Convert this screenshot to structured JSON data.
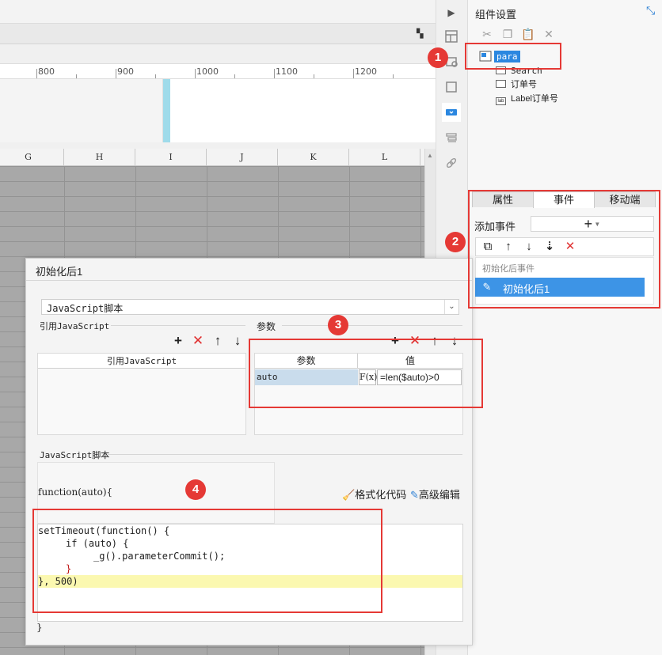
{
  "ruler": {
    "labels": [
      "800",
      "900",
      "1000",
      "1100",
      "1200"
    ]
  },
  "sheet": {
    "columns": [
      "G",
      "H",
      "I",
      "J",
      "K",
      "L"
    ]
  },
  "right_panel": {
    "title": "组件设置",
    "tree": {
      "root": "para",
      "children": [
        "Search",
        "订单号",
        "Label订单号"
      ]
    },
    "tabs": [
      "属性",
      "事件",
      "移动端"
    ],
    "add_event_label": "添加事件",
    "add_event_value": "+",
    "events": {
      "group": "初始化后事件",
      "selected": "初始化后1"
    }
  },
  "dialog": {
    "title": "初始化后1",
    "type": "JavaScript脚本",
    "ref_section": "引用JavaScript",
    "ref_header": "引用JavaScript",
    "param_section": "参数",
    "param_headers": [
      "参数",
      "值"
    ],
    "param_row": {
      "name": "auto",
      "fx": "F(x)",
      "value": "=len($auto)>0"
    },
    "script_section": "JavaScript脚本",
    "signature": "function(auto){",
    "format_label": "格式化代码",
    "advanced_label": "高级编辑",
    "closing": "}"
  },
  "code_lines": [
    "setTimeout(function() {",
    "if (auto) {",
    "_g().parameterCommit();",
    "}",
    "}, 500)"
  ],
  "annotations": [
    "1",
    "2",
    "3",
    "4"
  ],
  "colors": {
    "annotation": "#e53935",
    "selection": "#3d94e6",
    "tree_selected": "#2b87e0"
  }
}
